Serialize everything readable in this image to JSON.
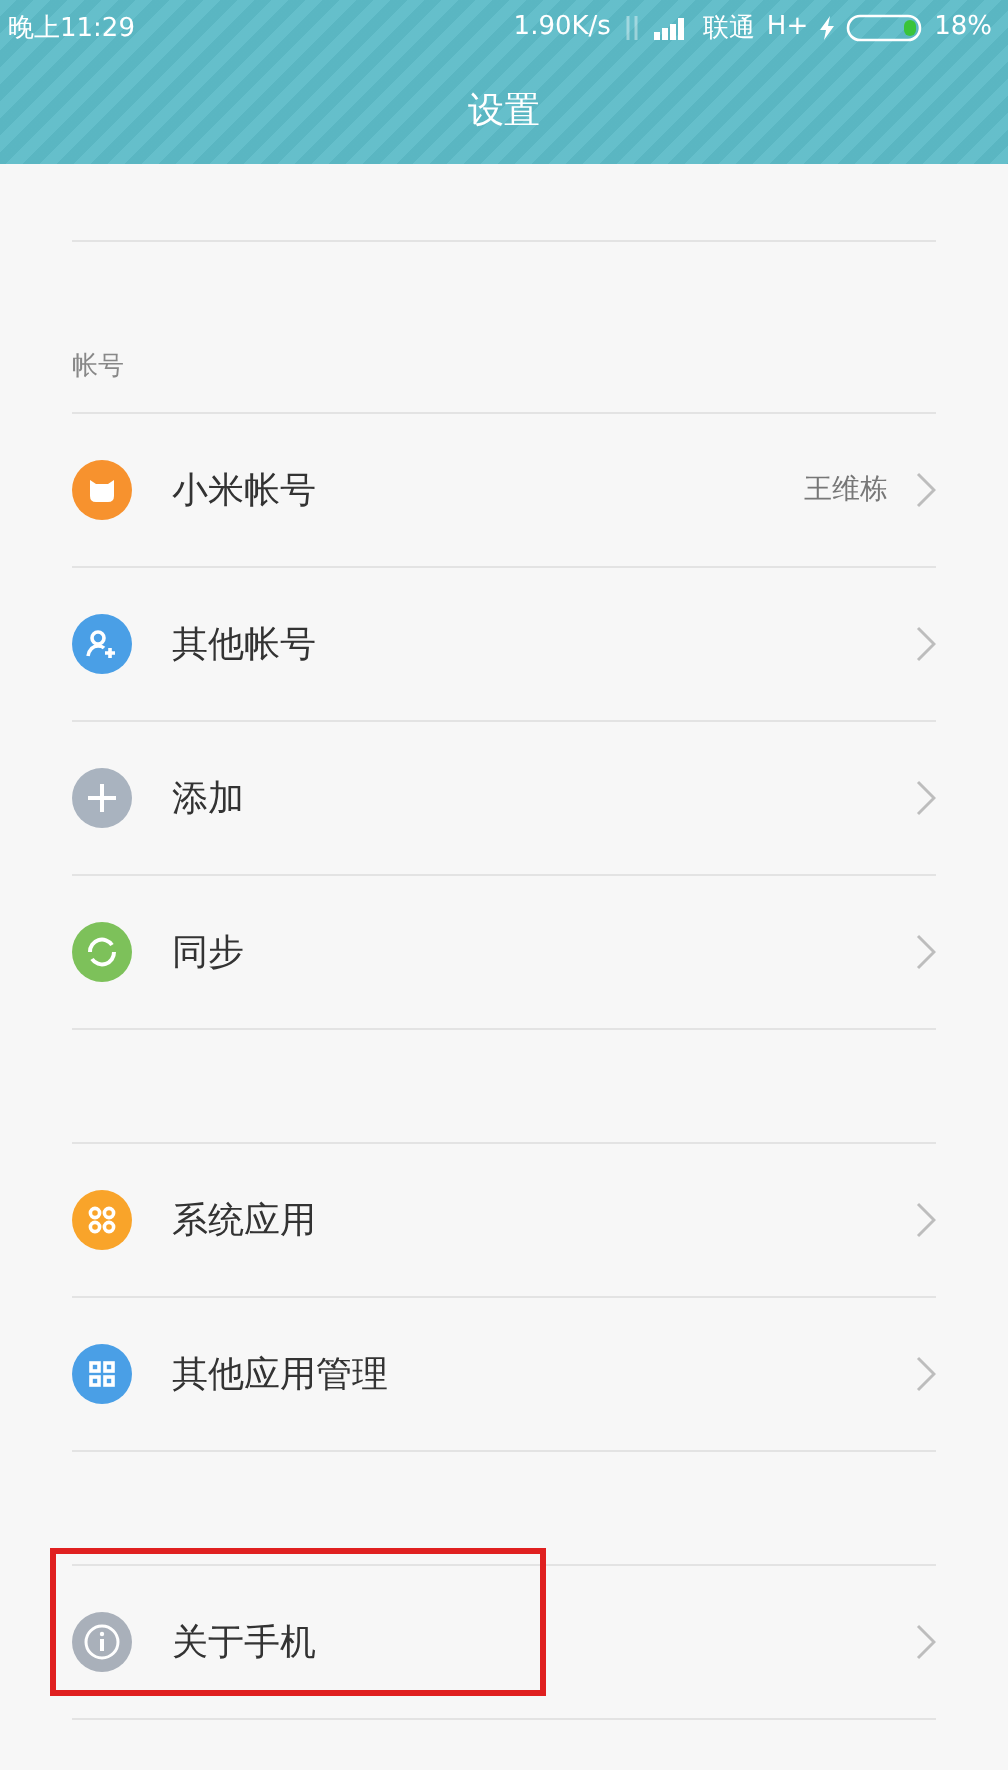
{
  "status_bar": {
    "time": "晚上11:29",
    "speed": "1.90K/s",
    "carrier": "联通",
    "network": "H+",
    "battery": "18%"
  },
  "header": {
    "title": "设置"
  },
  "groups": [
    {
      "header": "帐号",
      "items": [
        {
          "kind": "mi",
          "label": "小米帐号",
          "value": "王维栋",
          "highlighted": false
        },
        {
          "kind": "person-add",
          "label": "其他帐号",
          "highlighted": false
        },
        {
          "kind": "plus",
          "label": "添加",
          "highlighted": false
        },
        {
          "kind": "sync",
          "label": "同步",
          "highlighted": false
        }
      ]
    },
    {
      "items": [
        {
          "kind": "apps-round",
          "label": "系统应用",
          "highlighted": false
        },
        {
          "kind": "apps-square",
          "label": "其他应用管理",
          "highlighted": false
        }
      ]
    },
    {
      "items": [
        {
          "kind": "info",
          "label": "关于手机",
          "highlighted": true
        }
      ]
    }
  ]
}
